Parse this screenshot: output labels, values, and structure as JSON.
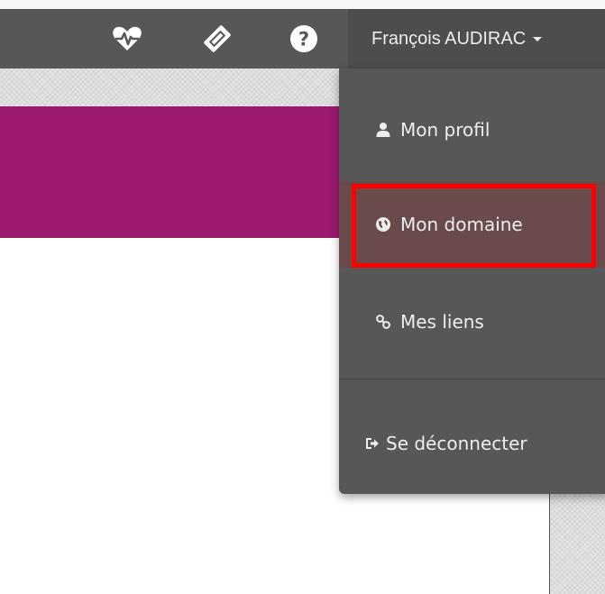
{
  "navbar": {
    "icons": [
      "heartbeat-icon",
      "ticket-icon",
      "help-icon"
    ],
    "user_name": "François AUDIRAC"
  },
  "user_menu": {
    "items": [
      {
        "label": "Mon profil",
        "icon": "user-icon"
      },
      {
        "label": "Mon domaine",
        "icon": "globe-icon",
        "highlighted": true
      },
      {
        "label": "Mes liens",
        "icon": "link-icon"
      },
      {
        "label": "Se déconnecter",
        "icon": "logout-icon"
      }
    ]
  },
  "colors": {
    "navbar": "#575757",
    "banner": "#9b1a70",
    "dropdown": "#575757",
    "highlight_border": "#ff0000",
    "active_item": "#6a4a4a"
  }
}
